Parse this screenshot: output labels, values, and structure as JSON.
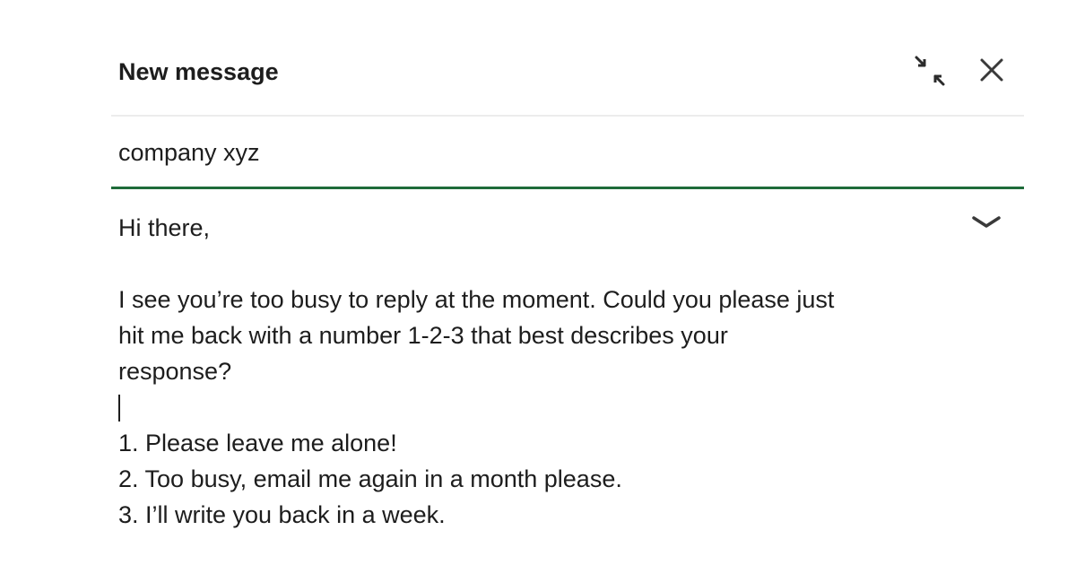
{
  "compose": {
    "title": "New message",
    "recipient": {
      "value": "company xyz"
    },
    "body": {
      "greeting": "Hi there,",
      "paragraph_lines": [
        "I see you’re too busy to reply at the moment. Could you please just",
        "hit me back with a number 1-2-3 that best describes your",
        "response?"
      ],
      "options": [
        "1. Please leave me alone!",
        "2. Too busy, email me again in a month please.",
        "3. I’ll write you back in a week."
      ]
    },
    "icons": {
      "collapse": "collapse-arrows-icon",
      "close": "close-icon",
      "expand": "chevron-down-icon"
    },
    "colors": {
      "focus_underline": "#1e6b3a",
      "text": "#1d1d1d",
      "divider": "#ececec"
    }
  }
}
